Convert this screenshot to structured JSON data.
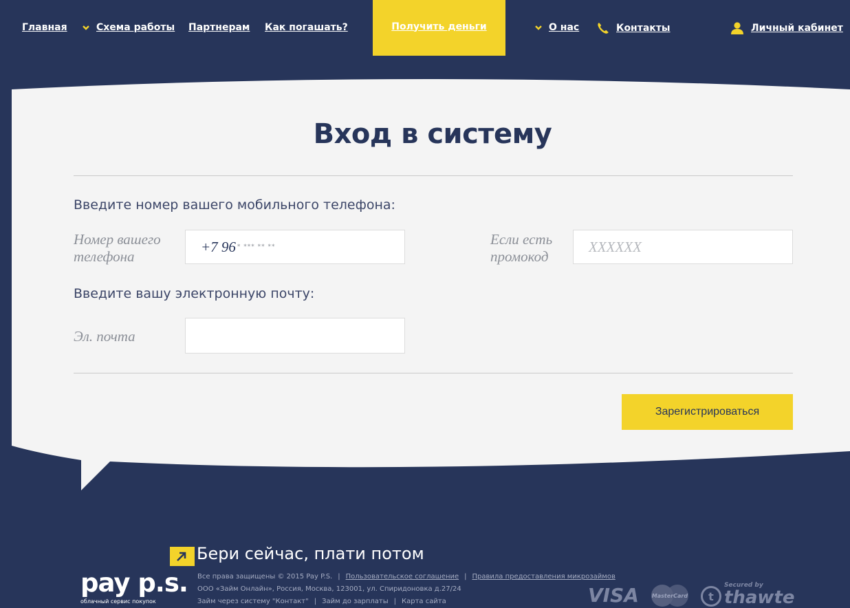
{
  "nav": {
    "home": "Главная",
    "scheme": "Схема работы",
    "partners": "Партнерам",
    "howtopay": "Как погашать?",
    "get_money": "Получить деньги",
    "about": "О нас",
    "contacts": "Контакты",
    "cabinet": "Личный кабинет"
  },
  "login": {
    "title": "Вход в систему",
    "phone_section": "Введите номер вашего мобильного телефона:",
    "phone_label_1": "Номер вашего",
    "phone_label_2": "телефона",
    "phone_prefix": "+7 96",
    "phone_mask": "* *** ** **",
    "promo_label_1": "Если есть",
    "promo_label_2": "промокод",
    "promo_placeholder": "XXXXXX",
    "email_section": "Введите вашу электронную почту:",
    "email_label": "Эл. почта",
    "email_value": "",
    "register_button": "Зарегистрироваться"
  },
  "footer": {
    "slogan": "Бери сейчас, плати потом",
    "logo": "pay p.s.",
    "logo_sub": "облачный сервис покупок",
    "copyright": "Все права защищены © 2015 Pay P.S.",
    "user_agreement": "Пользовательское соглашение",
    "loan_rules": "Правила предоставления микрозаймов",
    "company": "ООО «Займ Онлайн», Россия, Москва, 123001, ул. Спиридоновка д.27/24",
    "contact_loan": "Займ через систему \"Контакт\"",
    "salary_loan": "Займ до зарплаты",
    "sitemap": "Карта сайта",
    "visa": "VISA",
    "mastercard": "MasterCard",
    "thawte_secured": "Secured by",
    "thawte": "thawte",
    "thawte_t": "t"
  },
  "colors": {
    "navy": "#27355a",
    "yellow": "#f3d32a",
    "bubble": "#f4f4f4"
  },
  "icons": {
    "chevron": "chevron-down-icon",
    "phone": "phone-icon",
    "user": "user-icon",
    "arrow": "arrow-up-right-icon"
  }
}
